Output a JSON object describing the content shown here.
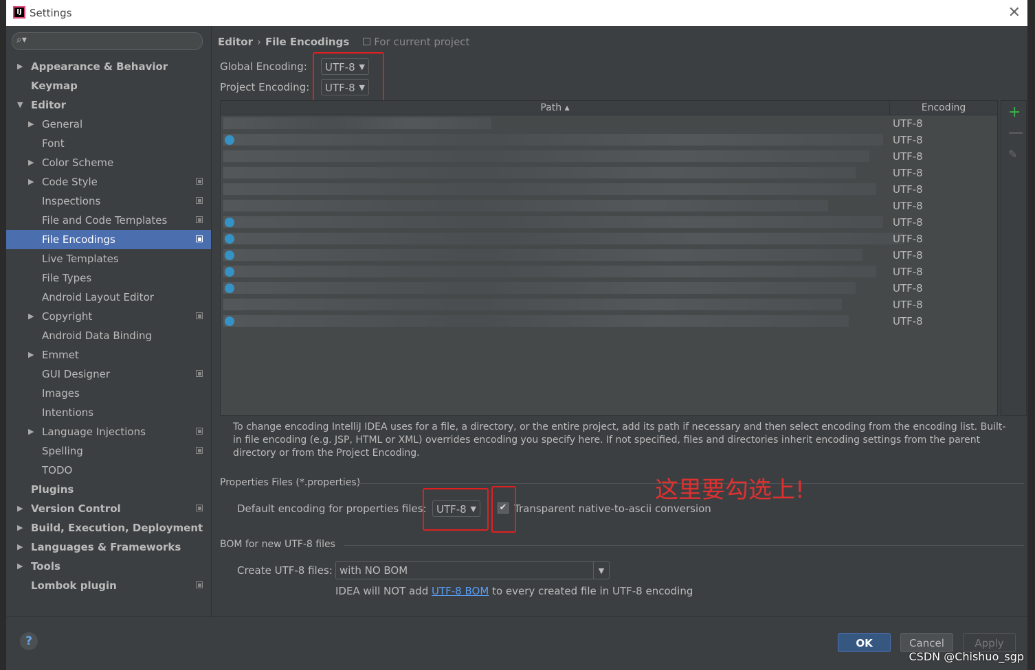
{
  "window": {
    "title": "Settings",
    "app_icon_letter": "IJ",
    "close_glyph": "✕"
  },
  "search": {
    "glyph": "⌕▾"
  },
  "tree": [
    {
      "label": "Appearance & Behavior",
      "bold": true,
      "level": 0,
      "arrow": "right",
      "proj": false
    },
    {
      "label": "Keymap",
      "bold": true,
      "level": 0,
      "arrow": "none",
      "proj": false
    },
    {
      "label": "Editor",
      "bold": true,
      "level": 0,
      "arrow": "down",
      "proj": false
    },
    {
      "label": "General",
      "bold": false,
      "level": 1,
      "arrow": "right",
      "proj": false
    },
    {
      "label": "Font",
      "bold": false,
      "level": 1,
      "arrow": "none",
      "proj": false
    },
    {
      "label": "Color Scheme",
      "bold": false,
      "level": 1,
      "arrow": "right",
      "proj": false
    },
    {
      "label": "Code Style",
      "bold": false,
      "level": 1,
      "arrow": "right",
      "proj": true
    },
    {
      "label": "Inspections",
      "bold": false,
      "level": 1,
      "arrow": "none",
      "proj": true
    },
    {
      "label": "File and Code Templates",
      "bold": false,
      "level": 1,
      "arrow": "none",
      "proj": true
    },
    {
      "label": "File Encodings",
      "bold": false,
      "level": 1,
      "arrow": "none",
      "proj": true,
      "selected": true
    },
    {
      "label": "Live Templates",
      "bold": false,
      "level": 1,
      "arrow": "none",
      "proj": false
    },
    {
      "label": "File Types",
      "bold": false,
      "level": 1,
      "arrow": "none",
      "proj": false
    },
    {
      "label": "Android Layout Editor",
      "bold": false,
      "level": 1,
      "arrow": "none",
      "proj": false
    },
    {
      "label": "Copyright",
      "bold": false,
      "level": 1,
      "arrow": "right",
      "proj": true
    },
    {
      "label": "Android Data Binding",
      "bold": false,
      "level": 1,
      "arrow": "none",
      "proj": false
    },
    {
      "label": "Emmet",
      "bold": false,
      "level": 1,
      "arrow": "right",
      "proj": false
    },
    {
      "label": "GUI Designer",
      "bold": false,
      "level": 1,
      "arrow": "none",
      "proj": true
    },
    {
      "label": "Images",
      "bold": false,
      "level": 1,
      "arrow": "none",
      "proj": false
    },
    {
      "label": "Intentions",
      "bold": false,
      "level": 1,
      "arrow": "none",
      "proj": false
    },
    {
      "label": "Language Injections",
      "bold": false,
      "level": 1,
      "arrow": "right",
      "proj": true
    },
    {
      "label": "Spelling",
      "bold": false,
      "level": 1,
      "arrow": "none",
      "proj": true
    },
    {
      "label": "TODO",
      "bold": false,
      "level": 1,
      "arrow": "none",
      "proj": false
    },
    {
      "label": "Plugins",
      "bold": true,
      "level": 0,
      "arrow": "none",
      "proj": false
    },
    {
      "label": "Version Control",
      "bold": true,
      "level": 0,
      "arrow": "right",
      "proj": true
    },
    {
      "label": "Build, Execution, Deployment",
      "bold": true,
      "level": 0,
      "arrow": "right",
      "proj": false
    },
    {
      "label": "Languages & Frameworks",
      "bold": true,
      "level": 0,
      "arrow": "right",
      "proj": false
    },
    {
      "label": "Tools",
      "bold": true,
      "level": 0,
      "arrow": "right",
      "proj": false
    },
    {
      "label": "Lombok plugin",
      "bold": true,
      "level": 0,
      "arrow": "none",
      "proj": true
    }
  ],
  "breadcrumb": {
    "parent": "Editor",
    "sep": "›",
    "current": "File Encodings",
    "scope": "For current project"
  },
  "global_encoding": {
    "label": "Global Encoding:",
    "value": "UTF-8"
  },
  "project_encoding": {
    "label": "Project Encoding:",
    "value": "UTF-8"
  },
  "table": {
    "col_path": "Path ▴",
    "col_encoding": "Encoding",
    "rows": [
      {
        "enc": "UTF-8",
        "icon": false,
        "w": 390
      },
      {
        "enc": "UTF-8",
        "icon": true,
        "w": 960
      },
      {
        "enc": "UTF-8",
        "icon": false,
        "w": 940
      },
      {
        "enc": "UTF-8",
        "icon": false,
        "w": 920
      },
      {
        "enc": "UTF-8",
        "icon": false,
        "w": 950
      },
      {
        "enc": "UTF-8",
        "icon": false,
        "w": 880
      },
      {
        "enc": "UTF-8",
        "icon": true,
        "w": 960
      },
      {
        "enc": "UTF-8",
        "icon": true,
        "w": 990
      },
      {
        "enc": "UTF-8",
        "icon": true,
        "w": 930
      },
      {
        "enc": "UTF-8",
        "icon": true,
        "w": 950
      },
      {
        "enc": "UTF-8",
        "icon": true,
        "w": 920
      },
      {
        "enc": "UTF-8",
        "icon": false,
        "w": 900
      },
      {
        "enc": "UTF-8",
        "icon": true,
        "w": 910
      }
    ],
    "add_glyph": "+",
    "remove_glyph": "—",
    "edit_glyph": "✎"
  },
  "description": "To change encoding IntelliJ IDEA uses for a file, a directory, or the entire project, add its path if necessary and then select encoding from the encoding list. Built-in file encoding (e.g. JSP, HTML or XML) overrides encoding you specify here. If not specified, files and directories inherit encoding settings from the parent directory or from the Project Encoding.",
  "properties": {
    "section": "Properties Files (*.properties)",
    "label": "Default encoding for properties files:",
    "value": "UTF-8",
    "checkbox_label": "Transparent native-to-ascii conversion",
    "checked": true,
    "check_glyph": "✔"
  },
  "annotation": "这里要勾选上!",
  "bom": {
    "section": "BOM for new UTF-8 files",
    "label": "Create UTF-8 files:",
    "value": "with NO BOM",
    "note_prefix": "IDEA will NOT add",
    "note_link": "UTF-8 BOM",
    "note_suffix": "to every created file in UTF-8 encoding"
  },
  "footer": {
    "help": "?",
    "ok": "OK",
    "cancel": "Cancel",
    "apply": "Apply"
  },
  "dropdown_glyph": "▼",
  "watermark": "CSDN @Chishuo_sgp",
  "colors": {
    "selection": "#4b6eaf",
    "accent_red": "#e02020",
    "add_green": "#3cb34a",
    "link": "#589df6"
  }
}
